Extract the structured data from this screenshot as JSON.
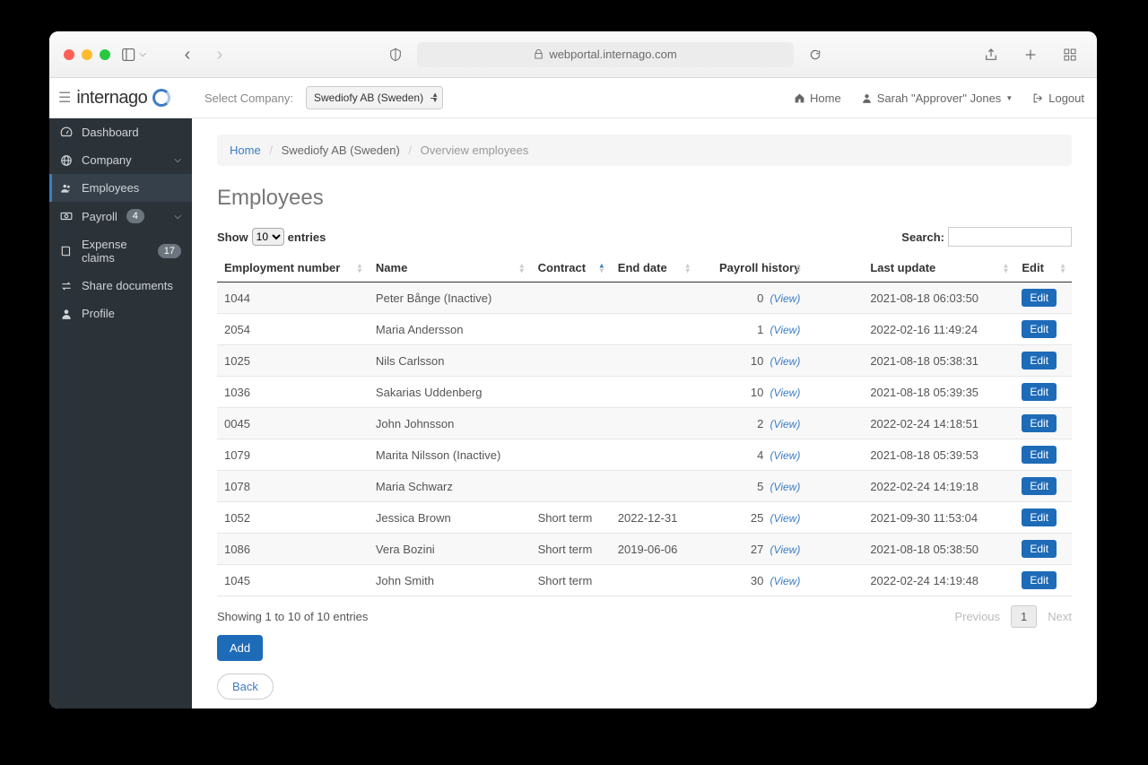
{
  "browser": {
    "url": "webportal.internago.com"
  },
  "topbar": {
    "select_company_label": "Select Company:",
    "company_selected": "Swediofy AB (Sweden)",
    "home_label": "Home",
    "user_label": "Sarah \"Approver\" Jones",
    "logout_label": "Logout"
  },
  "logo": {
    "text": "internago"
  },
  "sidebar": {
    "items": [
      {
        "icon": "tachometer",
        "label": "Dashboard"
      },
      {
        "icon": "globe",
        "label": "Company",
        "chevron": true
      },
      {
        "icon": "users",
        "label": "Employees",
        "active": true
      },
      {
        "icon": "money",
        "label": "Payroll",
        "badge": "4",
        "chevron": true
      },
      {
        "icon": "book",
        "label": "Expense claims",
        "badge": "17"
      },
      {
        "icon": "exchange",
        "label": "Share documents"
      },
      {
        "icon": "user",
        "label": "Profile"
      }
    ]
  },
  "breadcrumb": {
    "home": "Home",
    "company": "Swediofy AB (Sweden)",
    "current": "Overview employees"
  },
  "page": {
    "title": "Employees",
    "show_label_pre": "Show",
    "show_value": "10",
    "show_label_post": "entries",
    "search_label": "Search:"
  },
  "table": {
    "headers": {
      "emp_no": "Employment number",
      "name": "Name",
      "contract": "Contract",
      "end_date": "End date",
      "payroll": "Payroll history",
      "last_update": "Last update",
      "edit": "Edit"
    },
    "view_label": "(View)",
    "edit_label": "Edit",
    "rows": [
      {
        "emp_no": "1044",
        "name": "Peter Bånge (Inactive)",
        "contract": "",
        "end_date": "",
        "payroll": "0",
        "last_update": "2021-08-18 06:03:50"
      },
      {
        "emp_no": "2054",
        "name": "Maria Andersson",
        "contract": "",
        "end_date": "",
        "payroll": "1",
        "last_update": "2022-02-16 11:49:24"
      },
      {
        "emp_no": "1025",
        "name": "Nils Carlsson",
        "contract": "",
        "end_date": "",
        "payroll": "10",
        "last_update": "2021-08-18 05:38:31"
      },
      {
        "emp_no": "1036",
        "name": "Sakarias Uddenberg",
        "contract": "",
        "end_date": "",
        "payroll": "10",
        "last_update": "2021-08-18 05:39:35"
      },
      {
        "emp_no": "0045",
        "name": "John Johnsson",
        "contract": "",
        "end_date": "",
        "payroll": "2",
        "last_update": "2022-02-24 14:18:51"
      },
      {
        "emp_no": "1079",
        "name": "Marita Nilsson (Inactive)",
        "contract": "",
        "end_date": "",
        "payroll": "4",
        "last_update": "2021-08-18 05:39:53"
      },
      {
        "emp_no": "1078",
        "name": "Maria Schwarz",
        "contract": "",
        "end_date": "",
        "payroll": "5",
        "last_update": "2022-02-24 14:19:18"
      },
      {
        "emp_no": "1052",
        "name": "Jessica Brown",
        "contract": "Short term",
        "end_date": "2022-12-31",
        "payroll": "25",
        "last_update": "2021-09-30 11:53:04"
      },
      {
        "emp_no": "1086",
        "name": "Vera Bozini",
        "contract": "Short term",
        "end_date": "2019-06-06",
        "payroll": "27",
        "last_update": "2021-08-18 05:38:50"
      },
      {
        "emp_no": "1045",
        "name": "John Smith",
        "contract": "Short term",
        "end_date": "",
        "payroll": "30",
        "last_update": "2022-02-24 14:19:48"
      }
    ]
  },
  "footer": {
    "info": "Showing 1 to 10 of 10 entries",
    "prev": "Previous",
    "page": "1",
    "next": "Next",
    "add": "Add",
    "back": "Back"
  }
}
